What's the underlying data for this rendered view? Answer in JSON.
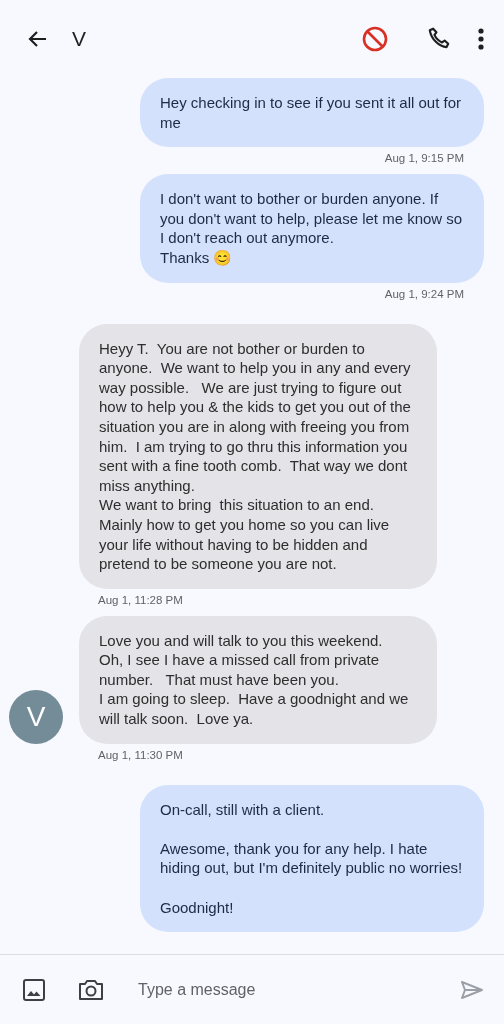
{
  "header": {
    "contact_name": "V"
  },
  "messages": [
    {
      "kind": "sent",
      "text": "Hey checking in to see if you sent it all out for me",
      "time": "Aug 1, 9:15 PM"
    },
    {
      "kind": "sent",
      "text": "I don't want to bother or burden anyone. If you don't want to help, please let me know so I don't reach out anymore.\nThanks 😊",
      "time": "Aug 1, 9:24 PM"
    },
    {
      "kind": "received",
      "text": "Heyy T.  You are not bother or burden to anyone.  We want to help you in any and every way possible.   We are just trying to figure out how to help you & the kids to get you out of the situation you are in along with freeing you from him.  I am trying to go thru this information you sent with a fine tooth comb.  That way we dont miss anything.\nWe want to bring  this situation to an end.\nMainly how to get you home so you can live your life without having to be hidden and pretend to be someone you are not.",
      "time": "Aug 1, 11:28 PM"
    },
    {
      "kind": "received",
      "text": "Love you and will talk to you this weekend.\nOh, I see I have a missed call from private number.   That must have been you.\nI am going to sleep.  Have a goodnight and we will talk soon.  Love ya.",
      "avatar": "V",
      "time": "Aug 1, 11:30 PM"
    },
    {
      "kind": "sent",
      "text": "On-call, still with a client.\n\nAwesome, thank you for any help. I hate hiding out, but I'm definitely public no worries!\n\nGoodnight!"
    }
  ],
  "composer": {
    "placeholder": "Type a message"
  }
}
